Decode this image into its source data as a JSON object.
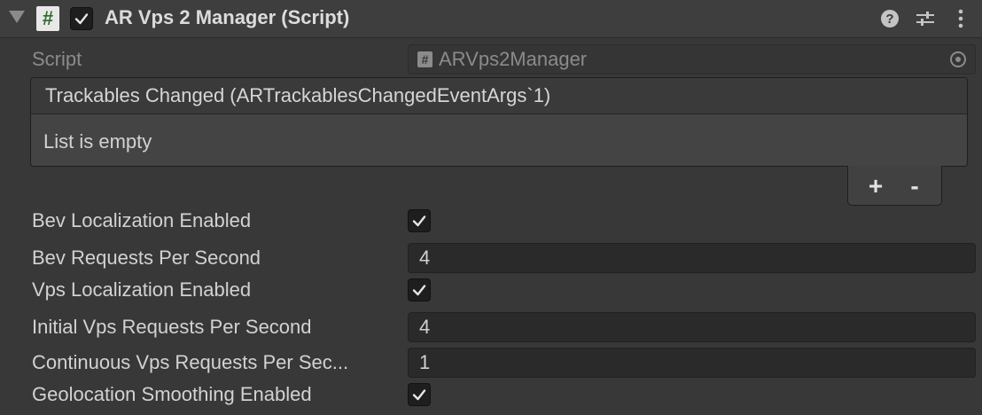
{
  "header": {
    "title": "AR Vps 2 Manager (Script)",
    "enabled": true,
    "script_icon_glyph": "#",
    "icons": [
      "foldout-arrow-icon",
      "script-icon",
      "help-icon",
      "preset-sliders-icon",
      "kebab-menu-icon"
    ]
  },
  "script_field": {
    "label": "Script",
    "value": "ARVps2Manager",
    "icon_glyph": "#"
  },
  "event": {
    "title": "Trackables Changed (ARTrackablesChangedEventArgs`1)",
    "empty_text": "List is empty",
    "add_label": "+",
    "remove_label": "-"
  },
  "properties": {
    "bev_localization": {
      "label": "Bev Localization Enabled",
      "checked": true
    },
    "bev_requests": {
      "label": "Bev Requests Per Second",
      "value": "4"
    },
    "vps_localization": {
      "label": "Vps Localization Enabled",
      "checked": true
    },
    "initial_vps_requests": {
      "label": "Initial Vps Requests Per Second",
      "value": "4"
    },
    "continuous_vps_requests": {
      "label": "Continuous Vps Requests Per Sec...",
      "value": "1"
    },
    "geolocation_smoothing": {
      "label": "Geolocation Smoothing Enabled",
      "checked": true
    }
  },
  "colors": {
    "background": "#383838",
    "header": "#3e3e3e",
    "field": "#2a2a2a",
    "text": "#d2d2d2",
    "disabled_text": "#8b8b8b"
  }
}
